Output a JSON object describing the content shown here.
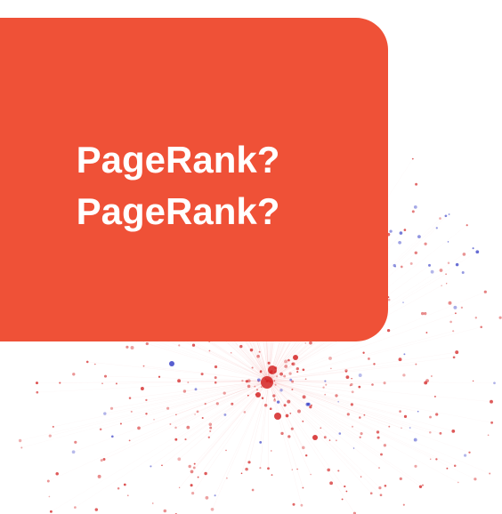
{
  "callout": {
    "lines": [
      "PageRank?",
      "PageRank?"
    ],
    "background": "#ef5137",
    "text_color": "#ffffff"
  },
  "graph": {
    "description_colors": {
      "red_nodes": "#d32424",
      "blue_nodes": "#3b43c8",
      "edges": "#f07a7a"
    }
  }
}
